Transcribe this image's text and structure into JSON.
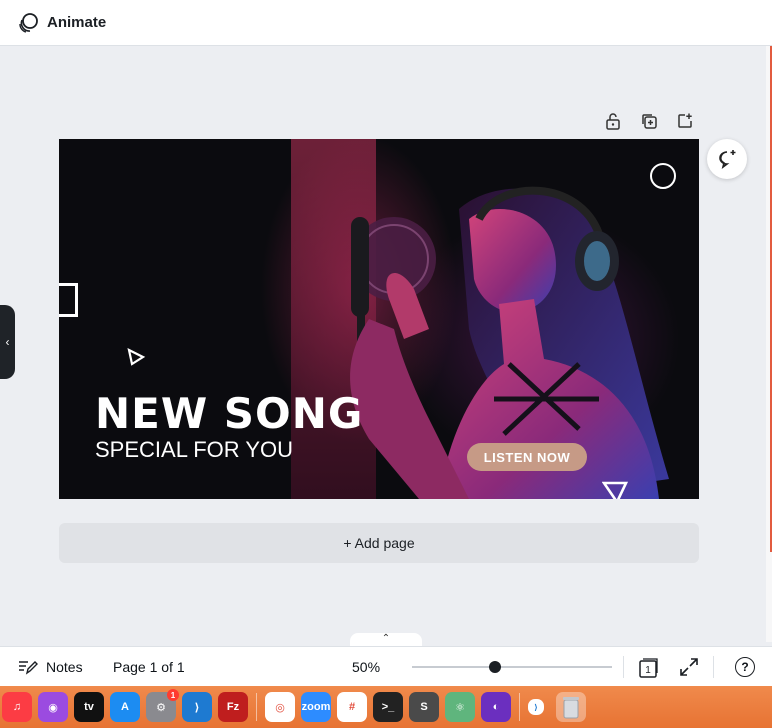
{
  "topbar": {
    "title": "Animate"
  },
  "design": {
    "headline": "NEW SONG",
    "subline": "SPECIAL FOR YOU",
    "cta": "LISTEN NOW"
  },
  "canvas": {
    "add_page_label": "+ Add page"
  },
  "statusbar": {
    "notes_label": "Notes",
    "page_indicator": "Page 1 of 1",
    "zoom_label": "50%",
    "zoom_value_percent": 50,
    "pages_count": "1",
    "help_label": "?",
    "expand_label": "⌃"
  },
  "dock": {
    "items": [
      {
        "name": "music-icon",
        "color": "#fc3c44",
        "glyph": "♫"
      },
      {
        "name": "podcasts-icon",
        "color": "#9b4be0",
        "glyph": "◉"
      },
      {
        "name": "apple-tv-icon",
        "color": "#111111",
        "glyph": "tv"
      },
      {
        "name": "app-store-icon",
        "color": "#1c8cf2",
        "glyph": "A"
      },
      {
        "name": "system-settings-icon",
        "color": "#8a8a8f",
        "glyph": "⚙",
        "badge": "1"
      },
      {
        "name": "vscode-icon",
        "color": "#1e7ad1",
        "glyph": "⟩"
      },
      {
        "name": "filezilla-icon",
        "color": "#bf1e1e",
        "glyph": "Fz"
      },
      {
        "name": "chrome-icon",
        "color": "#ffffff",
        "glyph": "◎"
      },
      {
        "name": "zoom-icon",
        "color": "#2d8cff",
        "glyph": "zoom"
      },
      {
        "name": "slack-icon",
        "color": "#ffffff",
        "glyph": "#"
      },
      {
        "name": "terminal-icon",
        "color": "#222222",
        "glyph": ">_"
      },
      {
        "name": "sublime-icon",
        "color": "#4a4a4a",
        "glyph": "S"
      },
      {
        "name": "atom-icon",
        "color": "#5fb57d",
        "glyph": "⚛"
      },
      {
        "name": "firefox-icon",
        "color": "#6b2fbf",
        "glyph": "◐"
      }
    ],
    "trash": {
      "name": "trash-icon"
    }
  }
}
